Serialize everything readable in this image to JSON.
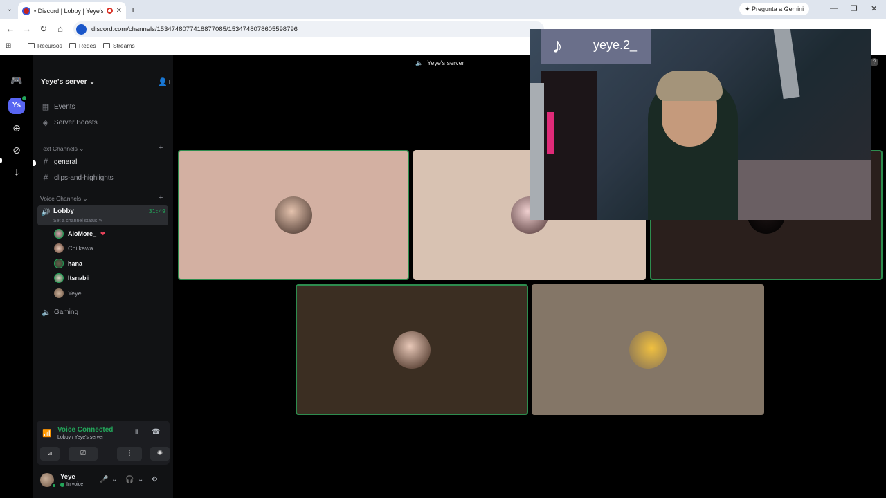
{
  "browser": {
    "tab_title": "• Discord | Lobby | Yeye's se",
    "gemini_label": "Pregunta a Gemini",
    "url": "discord.com/channels/1534748077418877085/1534748078605598796",
    "bookmarks": [
      "Recursos",
      "Redes",
      "Streams"
    ]
  },
  "server": {
    "name": "Yeye's server",
    "server_initials": "Ys",
    "events_label": "Events",
    "boosts_label": "Server Boosts",
    "text_category": "Text Channels",
    "text_channels": [
      "general",
      "clips-and-highlights"
    ],
    "voice_category": "Voice Channels",
    "lobby": {
      "name": "Lobby",
      "timer": "31:49",
      "status_placeholder": "Set a channel status"
    },
    "voice_users": [
      "AloMore_",
      "Chiikawa",
      "hana",
      "Itsnabii",
      "Yeye"
    ],
    "gaming_channel": "Gaming"
  },
  "voice_panel": {
    "title": "Voice Connected",
    "subtitle": "Lobby / Yeye's server"
  },
  "user": {
    "name": "Yeye",
    "status": "In voice"
  },
  "stage": {
    "title": "Yeye's server"
  },
  "overlay": {
    "tiktok_handle": "yeye.2_"
  },
  "colors": {
    "accent_green": "#23a55a",
    "blurple": "#5865f2",
    "tile_colors": [
      "#d3b0a2",
      "#d8c2b2",
      "#2a1f1c",
      "#3b2e22",
      "#847667"
    ]
  }
}
